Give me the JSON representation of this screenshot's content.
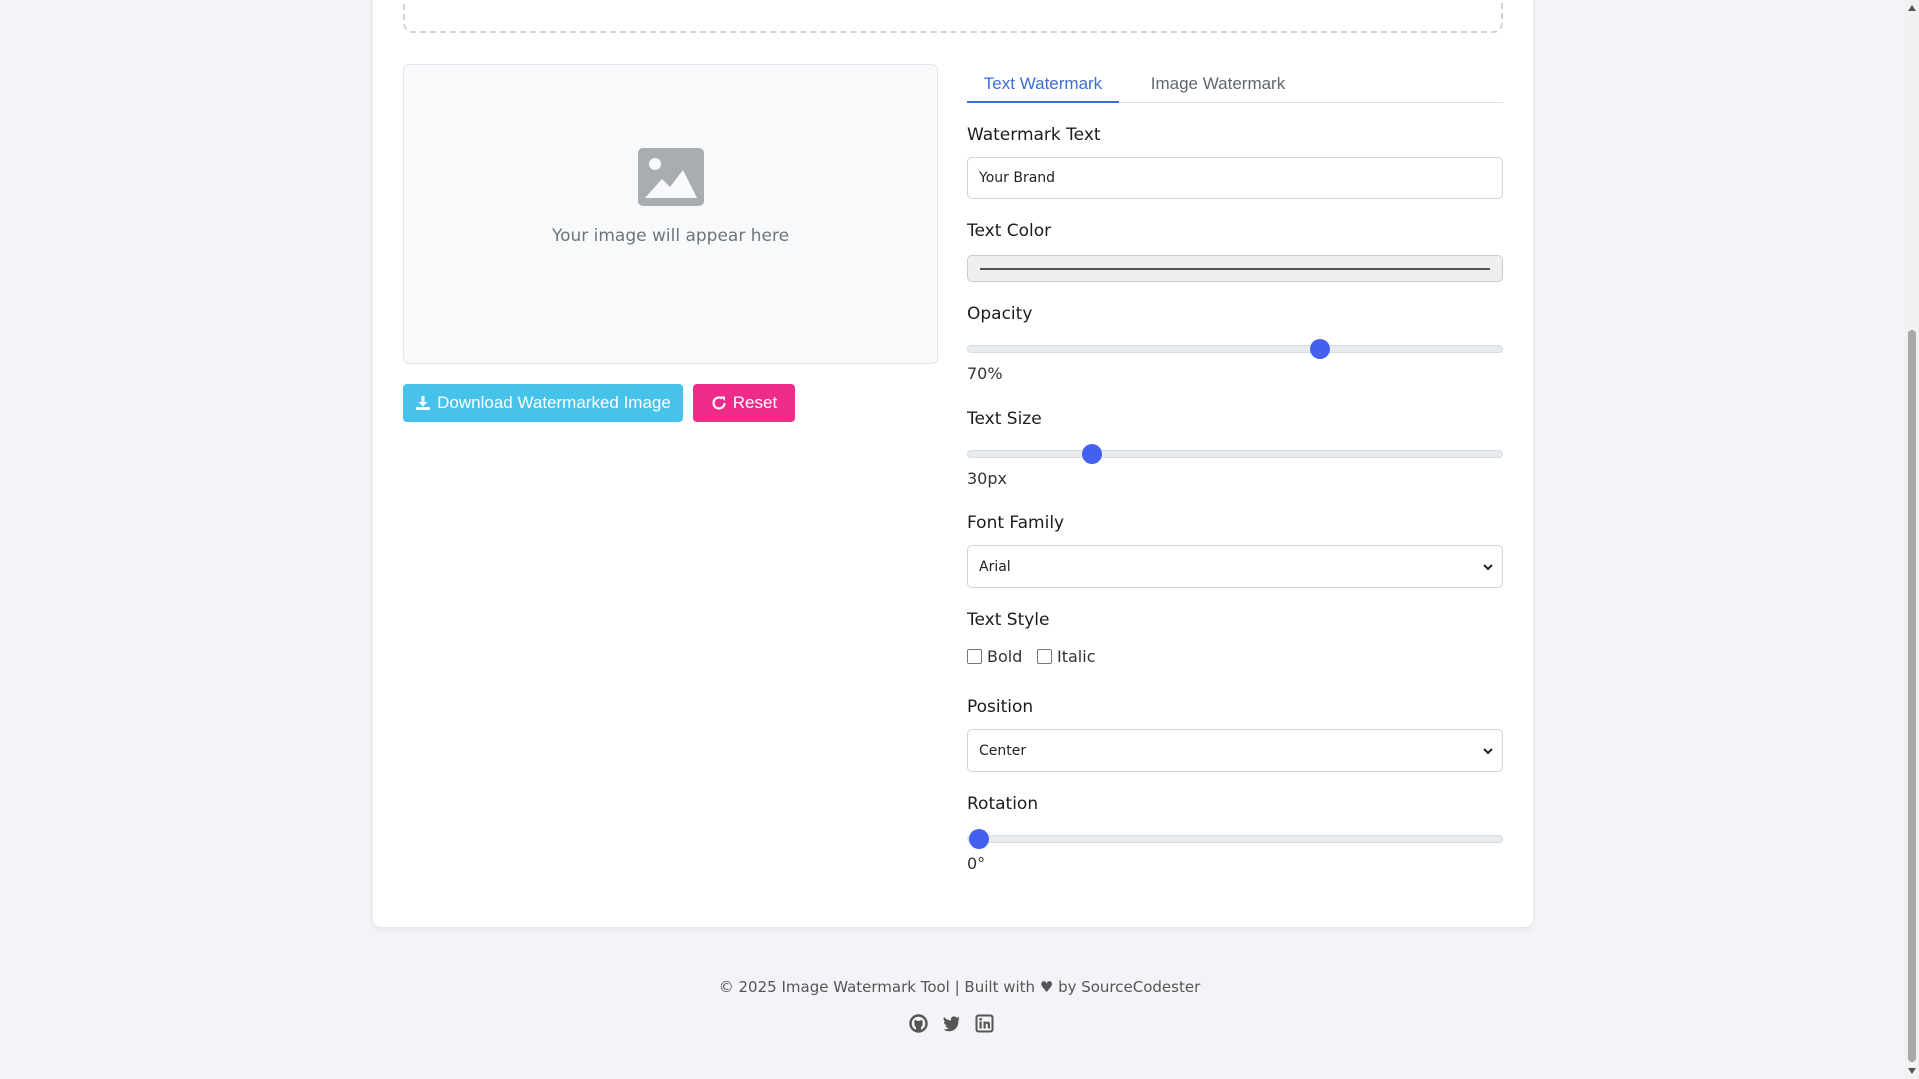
{
  "preview": {
    "placeholder_icon": "image-icon",
    "placeholder_text": "Your image will appear here"
  },
  "buttons": {
    "download_label": "Download Watermarked Image",
    "download_icon": "download-icon",
    "reset_label": "Reset",
    "reset_icon": "refresh-icon"
  },
  "tabs": [
    {
      "label": "Text Watermark",
      "active": true
    },
    {
      "label": "Image Watermark",
      "active": false
    }
  ],
  "form": {
    "watermark_text_label": "Watermark Text",
    "watermark_text_value": "Your Brand",
    "text_color_label": "Text Color",
    "opacity_label": "Opacity",
    "opacity_value": "70%",
    "opacity_fraction": 0.66,
    "text_size_label": "Text Size",
    "text_size_value": "30px",
    "text_size_fraction": 0.233,
    "font_family_label": "Font Family",
    "font_family_value": "Arial",
    "text_style_label": "Text Style",
    "bold_label": "Bold",
    "italic_label": "Italic",
    "position_label": "Position",
    "position_value": "Center",
    "rotation_label": "Rotation",
    "rotation_value": "0°",
    "rotation_fraction": 0.0
  },
  "footer": {
    "text_before": "© 2025 Image Watermark Tool | Built with",
    "text_after": "by SourceCodester",
    "icons": [
      "github-icon",
      "twitter-icon",
      "linkedin-icon"
    ]
  },
  "colors": {
    "accent": "#4460f1",
    "tab_active": "#3b6fd6",
    "download_button": "#47c2eb",
    "reset_button": "#ef2c8a"
  }
}
